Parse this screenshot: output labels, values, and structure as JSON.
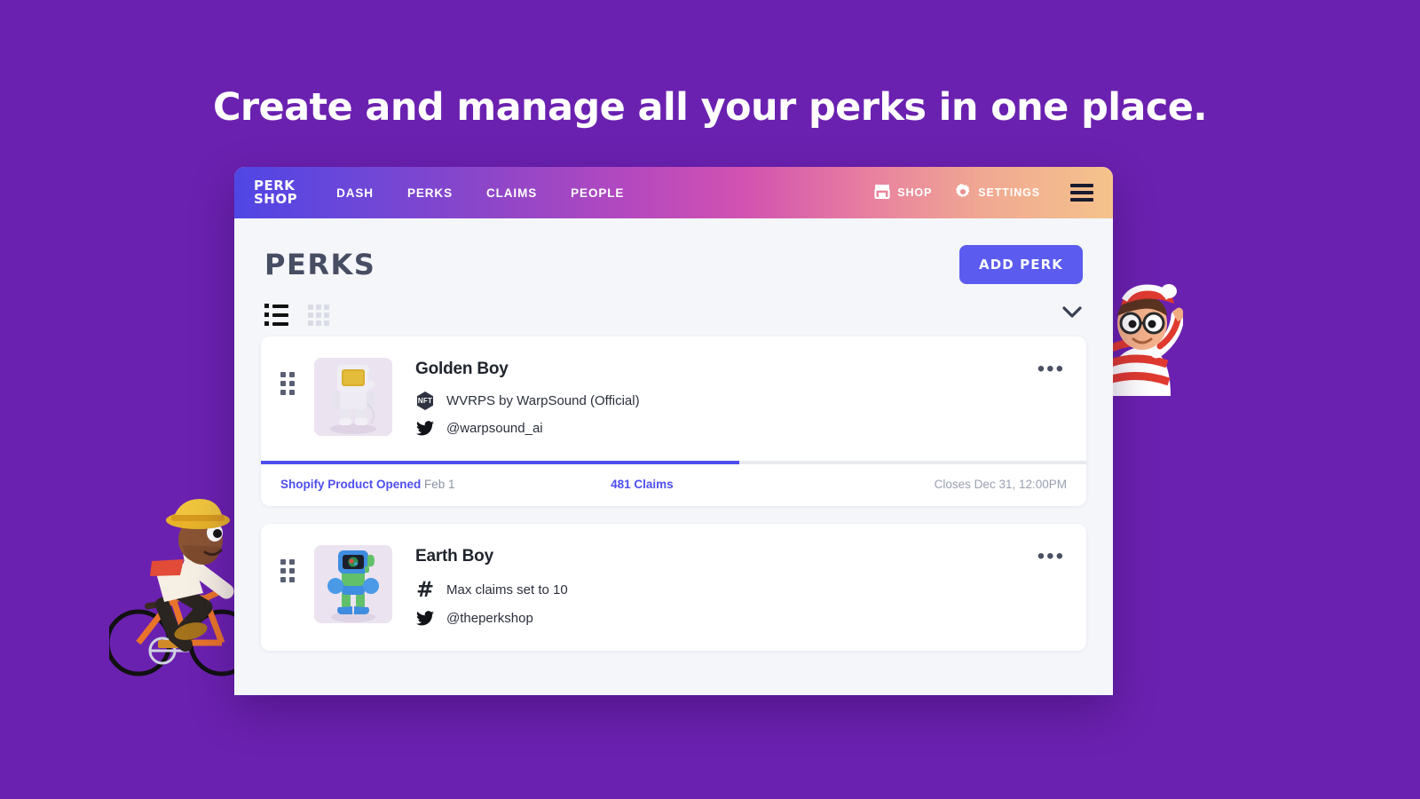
{
  "headline": "Create and manage all your perks in one place.",
  "theme": {
    "background_purple": "#6b21b0",
    "accent_indigo": "#5b5bef",
    "progress_blue": "#4e4ef0",
    "page_bg": "#f4f6fa",
    "title_slate": "#474d63"
  },
  "nav": {
    "logo_line1": "PERK",
    "logo_line2": "SHOP",
    "links": [
      {
        "label": "DASH"
      },
      {
        "label": "PERKS"
      },
      {
        "label": "CLAIMS"
      },
      {
        "label": "PEOPLE"
      }
    ],
    "right": [
      {
        "label": "SHOP",
        "icon": "store-icon"
      },
      {
        "label": "SETTINGS",
        "icon": "gear-icon"
      }
    ],
    "menu_icon": "hamburger-icon"
  },
  "page": {
    "title": "PERKS",
    "add_button": "ADD PERK"
  },
  "toolbar": {
    "list_view_icon": "list-view-icon",
    "grid_view_icon": "grid-view-icon",
    "expand_icon": "chevron-down-icon",
    "active_view": "list"
  },
  "perks": [
    {
      "name": "Golden Boy",
      "meta": [
        {
          "icon": "nft-badge-icon",
          "icon_text": "NFT",
          "text": "WVRPS by WarpSound (Official)"
        },
        {
          "icon": "twitter-icon",
          "text": "@warpsound_ai"
        }
      ],
      "progress_percent": 58,
      "footer": {
        "status_label": "Shopify Product Opened",
        "status_date": "Feb 1",
        "claims": "481 Claims",
        "closes": "Closes Dec 31, 12:00PM"
      },
      "menu_icon": "more-options-icon",
      "thumbnail_alt": "golden-boy-avatar"
    },
    {
      "name": "Earth Boy",
      "meta": [
        {
          "icon": "hash-icon",
          "text": "Max claims set to 10"
        },
        {
          "icon": "twitter-icon",
          "text": "@theperkshop"
        }
      ],
      "menu_icon": "more-options-icon",
      "thumbnail_alt": "earth-boy-avatar"
    }
  ]
}
